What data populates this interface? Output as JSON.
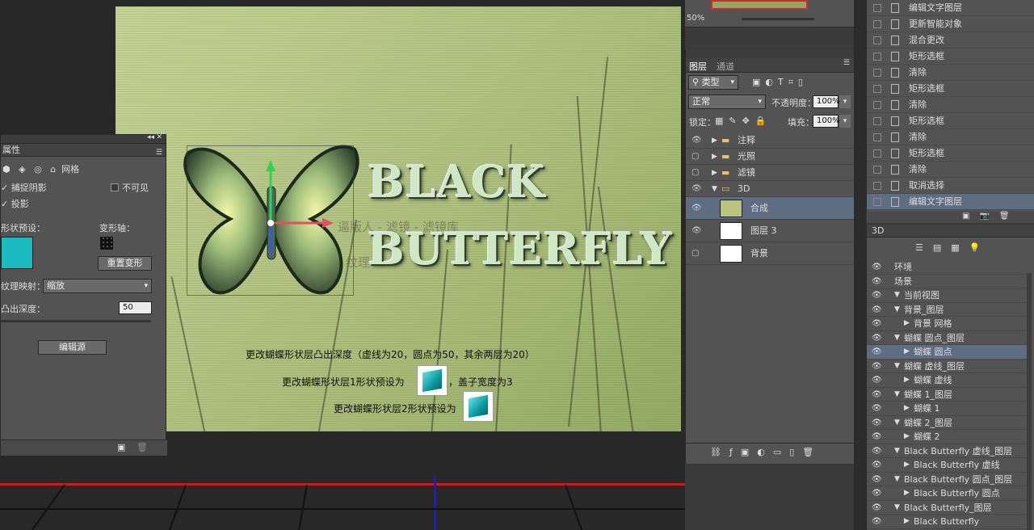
{
  "navigator": {
    "zoom": "50%"
  },
  "properties": {
    "title": "属性",
    "tab_mesh": "网格",
    "catch_shadow": "捕捉阴影",
    "invisible": "不可见",
    "cast_shadow": "投影",
    "shape_preset_label": "形状预设：",
    "deform_axis_label": "变形轴：",
    "reset_deform": "重置变形",
    "texture_map_label": "纹理映射：",
    "texture_map_value": "缩放",
    "extrude_depth_label": "凸出深度：",
    "extrude_depth_value": "50",
    "edit_source": "编辑源",
    "preset_color": "#1bbcc0"
  },
  "canvas": {
    "title_line1": "BLACK",
    "title_line2": "BUTTERFLY",
    "watermark1": "逼版人 - 滤镜 - 滤镜库",
    "watermark2": "纹理",
    "note1": "更改蝴蝶形状层凸出深度（虚线为20，圆点为50，其余两层为20）",
    "note2a": "更改蝴蝶形状层1形状预设为",
    "note2b": "，盖子宽度为3",
    "note3": "更改蝴蝶形状层2形状预设为"
  },
  "layers": {
    "tab_layers": "图层",
    "tab_channels": "通道",
    "filter_kind": "类型",
    "blend_mode": "正常",
    "opacity_label": "不透明度：",
    "opacity_value": "100%",
    "lock_label": "锁定：",
    "fill_label": "填充：",
    "fill_value": "100%",
    "items": [
      {
        "name": "注释",
        "type": "group",
        "visible": true
      },
      {
        "name": "光照",
        "type": "group",
        "visible": false
      },
      {
        "name": "滤镜",
        "type": "group",
        "visible": false
      },
      {
        "name": "3D",
        "type": "group-open",
        "visible": true
      },
      {
        "name": "合成",
        "type": "layer",
        "visible": true,
        "selected": true
      },
      {
        "name": "图层 3",
        "type": "layer",
        "visible": true
      },
      {
        "name": "背景",
        "type": "layer",
        "visible": false
      }
    ]
  },
  "history": {
    "items": [
      "编辑文字图层",
      "更新智能对象",
      "混合更改",
      "矩形选框",
      "清除",
      "矩形选框",
      "清除",
      "矩形选框",
      "清除",
      "矩形选框",
      "清除",
      "取消选择",
      "编辑文字图层"
    ]
  },
  "panel3d": {
    "title": "3D",
    "items": [
      {
        "label": "环境",
        "indent": 0
      },
      {
        "label": "场景",
        "indent": 0
      },
      {
        "label": "当前视图",
        "indent": 1
      },
      {
        "label": "背景_图层",
        "indent": 1
      },
      {
        "label": "背景 网格",
        "indent": 2
      },
      {
        "label": "蝴蝶 圆点_图层",
        "indent": 1
      },
      {
        "label": "蝴蝶 圆点",
        "indent": 2
      },
      {
        "label": "蝴蝶 虚线_图层",
        "indent": 1
      },
      {
        "label": "蝴蝶 虚线",
        "indent": 2
      },
      {
        "label": "蝴蝶 1_图层",
        "indent": 1
      },
      {
        "label": "蝴蝶 1",
        "indent": 2
      },
      {
        "label": "蝴蝶 2_图层",
        "indent": 1
      },
      {
        "label": "蝴蝶 2",
        "indent": 2
      },
      {
        "label": "Black Butterfly 虚线_图层",
        "indent": 1
      },
      {
        "label": "Black Butterfly 虚线",
        "indent": 2
      },
      {
        "label": "Black Butterfly 圆点_图层",
        "indent": 1
      },
      {
        "label": "Black Butterfly 圆点",
        "indent": 2
      },
      {
        "label": "Black Butterfly_图层",
        "indent": 1
      },
      {
        "label": "Black Butterfly",
        "indent": 2
      }
    ]
  }
}
